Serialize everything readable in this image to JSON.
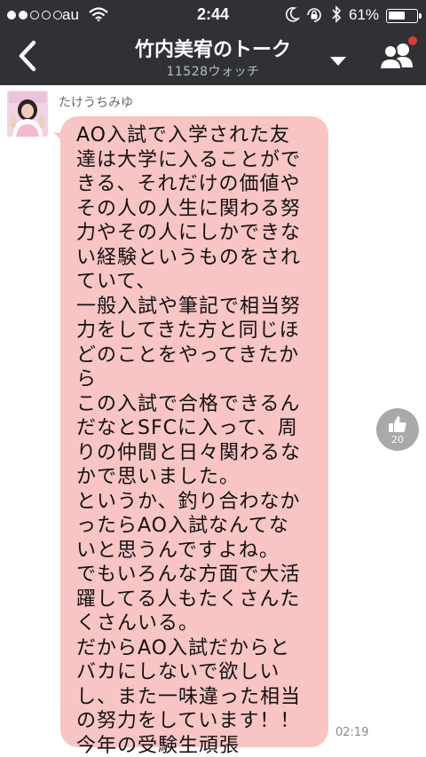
{
  "status_bar": {
    "signal_dots_full": 2,
    "signal_dots_total": 5,
    "carrier": "au",
    "time": "2:44",
    "battery_percent": "61%",
    "battery_level": 0.61
  },
  "header": {
    "title": "竹内美宥のトーク",
    "watch_count": "11528ウォッチ"
  },
  "message": {
    "sender": "たけうちみゆ",
    "text": "AO入試で入学された友\n達は大学に入ることがで\nきる、それだけの価値や\nその人の人生に関わる努\n力やその人にしかできな\nい経験というものをされ\nていて、\n一般入試や筆記で相当努\n力をしてきた方と同じほ\nどのことをやってきたか\nら\nこの入試で合格できるん\nだなとSFCに入って、周\nりの仲間と日々関わるな\nかで思いました。\nというか、釣り合わなか\nったらAO入試なんてな\nいと思うんですよね。\nでもいろんな方面で大活\n躍してる人もたくさんた\nくさんいる。\nだからAO入試だからと\nバカにしないで欲しい\nし、また一味違った相当\nの努力をしています！！\n今年の受験生頑張\nれ！！！",
    "likes": "20",
    "time": "02:19"
  },
  "colors": {
    "header_bg": "#2f3135",
    "bubble_bg": "#f8c4c4",
    "notification_dot": "#e53935"
  }
}
